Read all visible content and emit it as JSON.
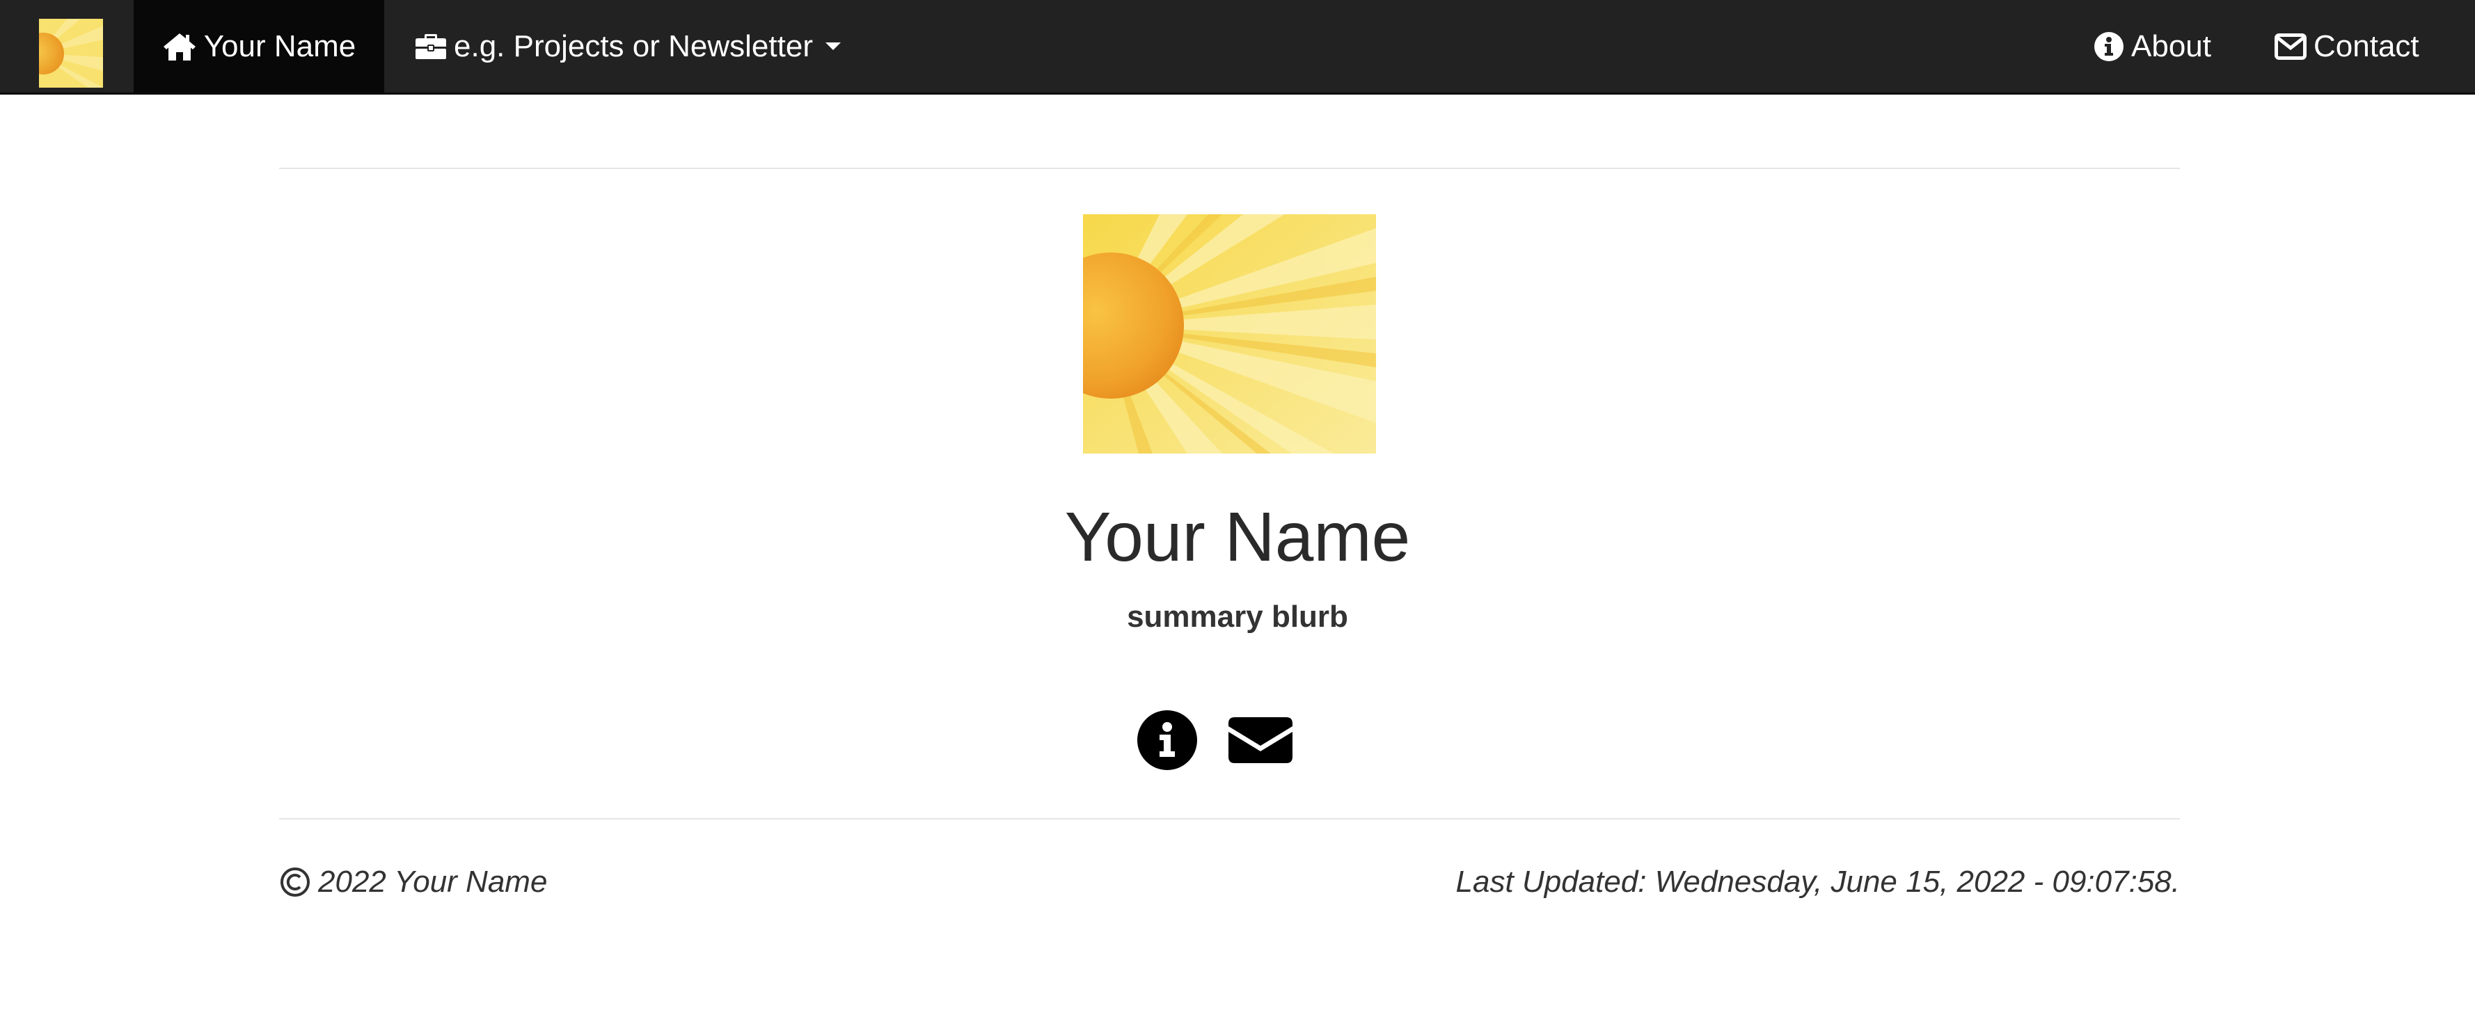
{
  "navbar": {
    "logo_icon": "sunflower-logo",
    "home": {
      "label": "Your Name",
      "icon": "home-icon"
    },
    "projects": {
      "label": "e.g. Projects or Newsletter",
      "icon": "briefcase-icon"
    },
    "about": {
      "label": "About",
      "icon": "info-circle-icon"
    },
    "contact": {
      "label": "Contact",
      "icon": "envelope-icon"
    }
  },
  "main": {
    "profile_image": "sunflower-image",
    "title": "Your Name",
    "summary": "summary blurb",
    "social_links": [
      {
        "name": "about",
        "icon": "info-circle-icon"
      },
      {
        "name": "contact",
        "icon": "envelope-icon"
      }
    ]
  },
  "footer": {
    "copyright": "2022 Your Name",
    "last_updated": "Last Updated: Wednesday, June 15, 2022 - 09:07:58."
  },
  "colors": {
    "navbar_bg": "#222222",
    "navbar_active_bg": "#080808",
    "text": "#333333",
    "divider": "#e5e5e5",
    "sun_center": "#f3a82c",
    "sun_petal": "#fae37a"
  }
}
